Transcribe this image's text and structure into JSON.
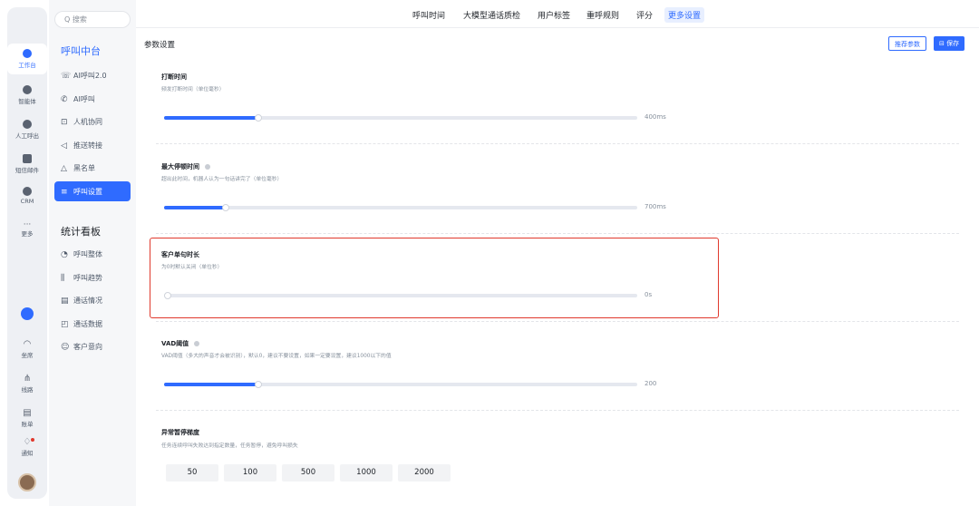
{
  "rail": {
    "items": [
      {
        "label": "工作台",
        "icon": "workbench-icon",
        "active": true
      },
      {
        "label": "智能体",
        "icon": "agent-icon"
      },
      {
        "label": "人工呼出",
        "icon": "call-out-icon"
      },
      {
        "label": "短信邮件",
        "icon": "message-icon"
      },
      {
        "label": "CRM",
        "icon": "crm-icon"
      },
      {
        "label": "更多",
        "icon": "more-icon",
        "glyph": "···"
      }
    ],
    "bottom": [
      {
        "label": "坐席",
        "glyph": "◠"
      },
      {
        "label": "线路",
        "glyph": "⋔"
      },
      {
        "label": "账单",
        "glyph": "▤"
      },
      {
        "label": "通知",
        "glyph": "♢"
      }
    ]
  },
  "nav": {
    "search_placeholder": "Q 搜索",
    "group1": "呼叫中台",
    "group1_items": [
      {
        "label": "AI呼叫2.0",
        "icon": "☏"
      },
      {
        "label": "AI呼叫",
        "icon": "✆"
      },
      {
        "label": "人机协同",
        "icon": "⊡"
      },
      {
        "label": "推送转接",
        "icon": "◁"
      },
      {
        "label": "黑名单",
        "icon": "△"
      },
      {
        "label": "呼叫设置",
        "icon": "≡",
        "active": true
      }
    ],
    "group2": "统计看板",
    "group2_items": [
      {
        "label": "呼叫整体",
        "icon": "◔"
      },
      {
        "label": "呼叫趋势",
        "icon": "⫼"
      },
      {
        "label": "通话情况",
        "icon": "▤"
      },
      {
        "label": "通话数据",
        "icon": "◰"
      },
      {
        "label": "客户意向",
        "icon": "☺"
      }
    ]
  },
  "tabs": [
    "呼叫时间",
    "大模型通话质检",
    "用户标签",
    "重呼规则",
    "评分",
    "更多设置"
  ],
  "active_tab": "更多设置",
  "header": {
    "title": "参数设置",
    "recommend_btn": "推荐参数",
    "save_btn": "保存"
  },
  "settings": [
    {
      "title": "打断时间",
      "desc": "频发打断时间（单位毫秒）",
      "value": "400ms",
      "level": 0.2,
      "help": false
    },
    {
      "title": "最大停顿时间",
      "desc": "超出此时间，机器人认为一句话讲完了（单位毫秒）",
      "value": "700ms",
      "level": 0.13,
      "help": true
    },
    {
      "title": "客户单句时长",
      "desc": "为0时默认关闭（单位秒）",
      "value": "0s",
      "level": 0,
      "help": false
    },
    {
      "title": "VAD阈值",
      "desc": "VAD阈值（多大的声音才会被识别），默认0，建议不要设置，如果一定要设置，建议1000以下的值",
      "value": "200",
      "level": 0.2,
      "help": true
    }
  ],
  "pause": {
    "title": "异常暂停梯度",
    "desc": "任务连续呼叫失败达到指定数量，任务暂停，避免呼叫损失",
    "options": [
      "50",
      "100",
      "500",
      "1000",
      "2000"
    ]
  },
  "colors": {
    "accent": "#2f6bff",
    "highlight": "#e0392d"
  }
}
